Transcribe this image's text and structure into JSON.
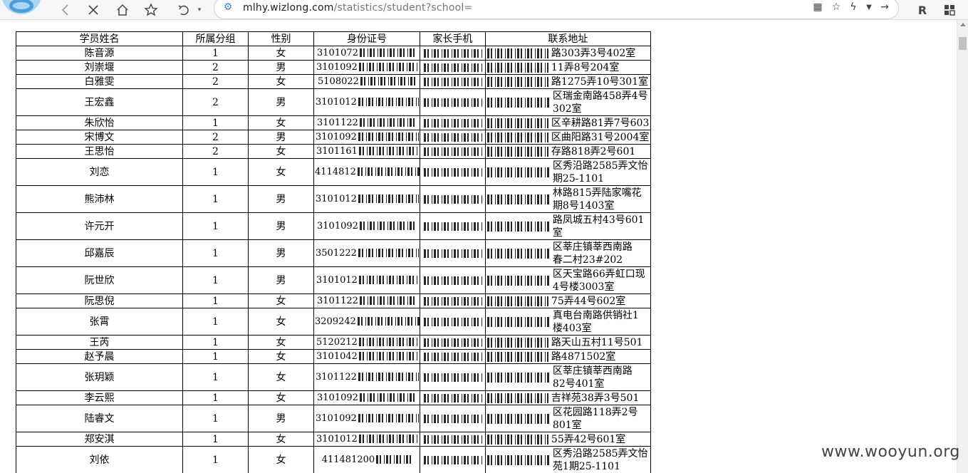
{
  "browser": {
    "url_host": "mlhy.wizlong.com",
    "url_path": "/statistics/student?school=",
    "nav": {
      "back_icon": "back-icon",
      "stop_icon": "close-icon",
      "home_icon": "home-icon",
      "favorite_icon": "star-icon",
      "undo_icon": "undo-icon"
    }
  },
  "table": {
    "headers": [
      "学员姓名",
      "所属分组",
      "性别",
      "身份证号",
      "家长手机",
      "联系地址"
    ],
    "rows": [
      {
        "name": "陈音源",
        "group": "1",
        "gender": "女",
        "id": "3101072",
        "addr": [
          "路303弄3号402室"
        ]
      },
      {
        "name": "刘崇堰",
        "group": "2",
        "gender": "男",
        "id": "3101092",
        "addr": [
          "11弄8号204室"
        ]
      },
      {
        "name": "白雅雯",
        "group": "2",
        "gender": "女",
        "id": "5108022",
        "addr": [
          "路1275弄10号301室"
        ]
      },
      {
        "name": "王宏鑫",
        "group": "2",
        "gender": "男",
        "id": "3101012",
        "addr": [
          "区瑞金南路458弄4号",
          "302室"
        ]
      },
      {
        "name": "朱欣怡",
        "group": "1",
        "gender": "女",
        "id": "3101122",
        "addr": [
          "区辛耕路81弄7号603"
        ]
      },
      {
        "name": "宋博文",
        "group": "2",
        "gender": "男",
        "id": "3101092",
        "addr": [
          "区曲阳路31号2004室"
        ]
      },
      {
        "name": "王思怡",
        "group": "2",
        "gender": "女",
        "id": "3101161",
        "addr": [
          "存路818弄2号601"
        ]
      },
      {
        "name": "刘恋",
        "group": "1",
        "gender": "女",
        "id": "4114812",
        "addr": [
          "区秀沿路2585弄文怡",
          "期25-1101"
        ]
      },
      {
        "name": "熊沛林",
        "group": "1",
        "gender": "男",
        "id": "3101012",
        "addr": [
          "林路815弄陆家嘴花",
          "期8号1403室"
        ]
      },
      {
        "name": "许元开",
        "group": "1",
        "gender": "男",
        "id": "3101092",
        "addr": [
          "路凤城五村43号601",
          "室"
        ]
      },
      {
        "name": "邱嘉辰",
        "group": "1",
        "gender": "男",
        "id": "3501222",
        "addr": [
          "区莘庄镇莘西南路",
          "春二村23#202"
        ]
      },
      {
        "name": "阮世欣",
        "group": "1",
        "gender": "男",
        "id": "3101012",
        "addr": [
          "区天宝路66弄虹口现",
          "4号楼3003室"
        ]
      },
      {
        "name": "阮思倪",
        "group": "1",
        "gender": "女",
        "id": "3101122",
        "addr": [
          "75弄44号602室"
        ]
      },
      {
        "name": "张霄",
        "group": "1",
        "gender": "女",
        "id": "3209242",
        "addr": [
          "真电台南路供销社1",
          "楼403室"
        ]
      },
      {
        "name": "王芮",
        "group": "1",
        "gender": "女",
        "id": "5120212",
        "addr": [
          "路天山五村11号501"
        ]
      },
      {
        "name": "赵予晨",
        "group": "1",
        "gender": "女",
        "id": "3101042",
        "addr": [
          "路4871502室"
        ]
      },
      {
        "name": "张玥颖",
        "group": "1",
        "gender": "女",
        "id": "3101122",
        "addr": [
          "区莘庄镇莘西南路",
          "82号401室"
        ]
      },
      {
        "name": "李云熙",
        "group": "1",
        "gender": "女",
        "id": "3101092",
        "addr": [
          "吉祥苑38弄3号501"
        ]
      },
      {
        "name": "陆睿文",
        "group": "1",
        "gender": "男",
        "id": "3101092",
        "addr": [
          "区花园路118弄2号",
          "801室"
        ]
      },
      {
        "name": "郑安淇",
        "group": "1",
        "gender": "女",
        "id": "3101012",
        "addr": [
          "55弄42号601室"
        ]
      },
      {
        "name": "刘依",
        "group": "1",
        "gender": "女",
        "id": "411481200",
        "addr": [
          "区秀沿路2585弄文怡",
          "苑1期25-1101"
        ]
      }
    ]
  },
  "watermark": "www.wooyun.org"
}
